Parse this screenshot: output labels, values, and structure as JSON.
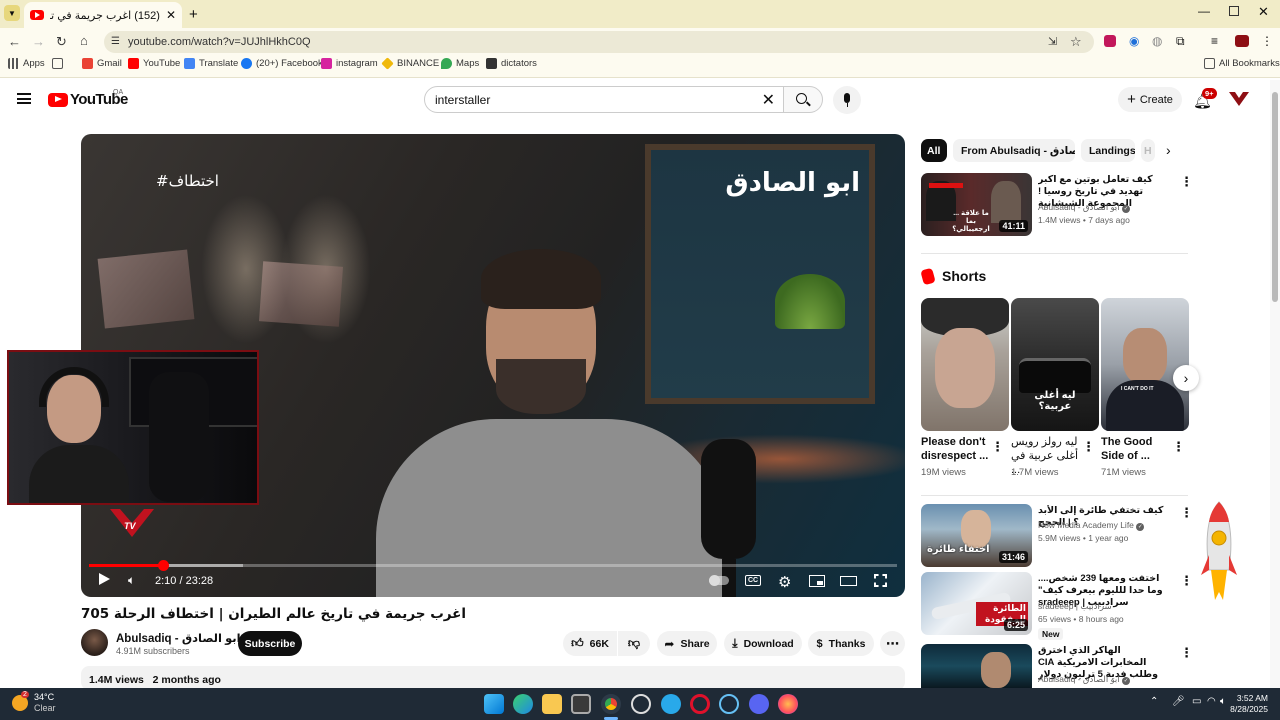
{
  "browser": {
    "tab_title": "(152) اغرب جريمة في تاريخ عالم",
    "url": "youtube.com/watch?v=JUJhlHkhC0Q",
    "bookmarks": [
      "Apps",
      "Gmail",
      "YouTube",
      "Translate",
      "(20+) Facebook",
      "instagram",
      "BINANCE",
      "Maps",
      "dictators"
    ],
    "all_bookmarks": "All Bookmarks"
  },
  "youtube": {
    "logo": "YouTube",
    "region": "QA",
    "search_value": "interstaller",
    "create": "Create",
    "notif_badge": "9+"
  },
  "video": {
    "title": "اغرب جريمة في تاريخ عالم الطيران | اختطاف الرحلة 705",
    "watermark": "ابو الصادق",
    "hashtag": "#اختطاف",
    "time": "2:10 / 23:28",
    "progress": 0.092,
    "buffered": 0.19,
    "overlay_logo": "TV",
    "channel": "Abulsadiq - ابو الصادق",
    "subscribers": "4.91M subscribers",
    "subscribe": "Subscribe",
    "likes": "66K",
    "share": "Share",
    "download": "Download",
    "thanks": "Thanks",
    "views": "1.4M views",
    "age": "2 months ago"
  },
  "chips": [
    "All",
    "From Abulsadiq - ابو الصادق",
    "Landings",
    "H"
  ],
  "related_top": {
    "title": "كيف تعامل بوتين مع اكبر تهديد في تاريخ روسيا ! المجموعة الشيشانية",
    "channel": "Abulsadiq - ابو الصادق",
    "meta": "1.4M views • 7 days ago",
    "duration": "41:11",
    "thumb_text": "ما علاقة ... بما ارجعيبالي؟"
  },
  "shorts": {
    "heading": "Shorts",
    "items": [
      {
        "title": "Please don't disrespect ...",
        "views": "19M views"
      },
      {
        "title": "ليه رولز رويس أغلى عربية في ...",
        "views": "1.7M views",
        "thumb_text": "ليه أغلى عربية؟"
      },
      {
        "title": "The Good Side of ...",
        "views": "71M views",
        "thumb_text": "I CAN'T DO IT"
      }
    ]
  },
  "related": [
    {
      "title": "كيف تختفي طائرة إلى الأبد ؟ | الحجج",
      "channel": "New Media Academy Life",
      "meta": "5.9M views • 1 year ago",
      "duration": "31:46",
      "thumb_text": "اختفاء طائرة"
    },
    {
      "title": "اختفت ومعها 239 شخص.... وما حدا للليوم بيعرف كيف\" سرادبيب | sradeeep",
      "channel": "sradeeep | سرادبيب",
      "meta": "65 views • 8 hours ago",
      "duration": "6:25",
      "badge": "New",
      "thumb_text": "الطائرة المفقودة"
    },
    {
      "title": "الهاكر الذي اخترق المخابرات الامريكية CIA وطلب فدية 5 ترليون دولار",
      "channel": "Abulsadiq - ابو الصادق",
      "meta": "",
      "thumb_text": ""
    }
  ],
  "taskbar": {
    "weather_temp": "34°C",
    "weather_desc": "Clear",
    "weather_badge": "2",
    "time": "3:52 AM",
    "date": "8/28/2025"
  },
  "colors": {
    "brand": "#ff0000",
    "chrome_tab": "#f1ecc8",
    "taskbar": "#1f2a36"
  }
}
